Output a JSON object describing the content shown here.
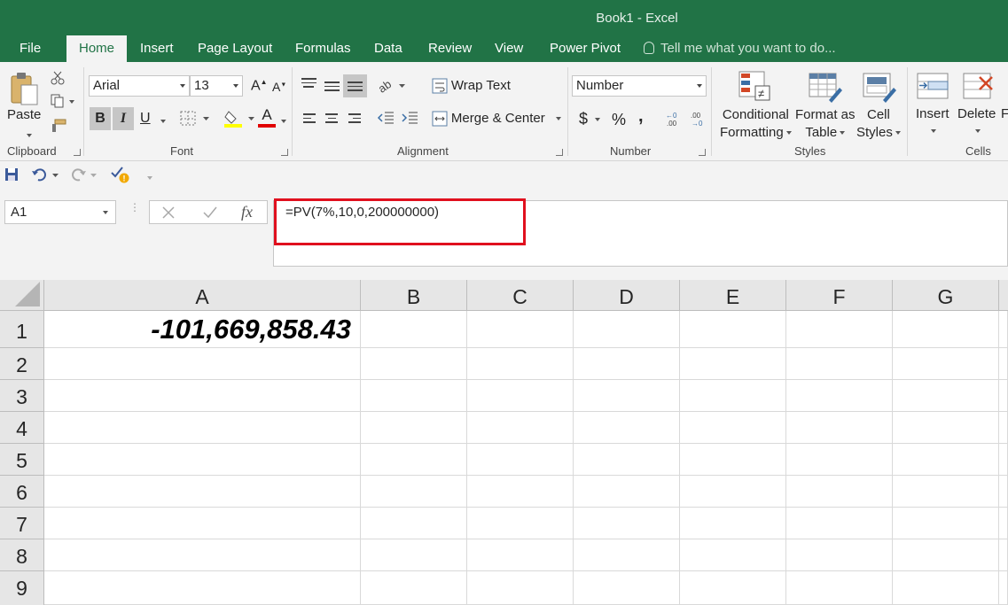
{
  "window": {
    "title": "Book1 - Excel"
  },
  "tabs": [
    {
      "label": "File"
    },
    {
      "label": "Home"
    },
    {
      "label": "Insert"
    },
    {
      "label": "Page Layout"
    },
    {
      "label": "Formulas"
    },
    {
      "label": "Data"
    },
    {
      "label": "Review"
    },
    {
      "label": "View"
    },
    {
      "label": "Power Pivot"
    }
  ],
  "tell_me": "Tell me what you want to do...",
  "ribbon": {
    "clipboard": {
      "paste_label": "Paste",
      "group_label": "Clipboard"
    },
    "font": {
      "name": "Arial",
      "size": "13",
      "bold": "B",
      "italic": "I",
      "underline": "U",
      "font_color_glyph": "A",
      "group_label": "Font",
      "highlight_color": "#ffff00",
      "font_color": "#e00000"
    },
    "alignment": {
      "wrap_text": "Wrap Text",
      "merge_center": "Merge & Center",
      "group_label": "Alignment"
    },
    "number": {
      "format": "Number",
      "currency": "$",
      "percent": "%",
      "comma": ",",
      "group_label": "Number"
    },
    "styles": {
      "conditional": "Conditional",
      "formatting": "Formatting",
      "format_as": "Format as",
      "table": "Table",
      "cell": "Cell",
      "styles_word": "Styles",
      "group_label": "Styles"
    },
    "cells": {
      "insert": "Insert",
      "delete": "Delete",
      "format_partial": "F",
      "group_label": "Cells"
    }
  },
  "formula_bar": {
    "name_box": "A1",
    "fx": "fx",
    "formula": "=PV(7%,10,0,200000000)"
  },
  "grid": {
    "columns": [
      "A",
      "B",
      "C",
      "D",
      "E",
      "F",
      "G"
    ],
    "rows": [
      "1",
      "2",
      "3",
      "4",
      "5",
      "6",
      "7",
      "8",
      "9"
    ],
    "cell_a1": "-101,669,858.43"
  },
  "colors": {
    "excel_green": "#217346",
    "highlight_red": "#e0101e"
  }
}
